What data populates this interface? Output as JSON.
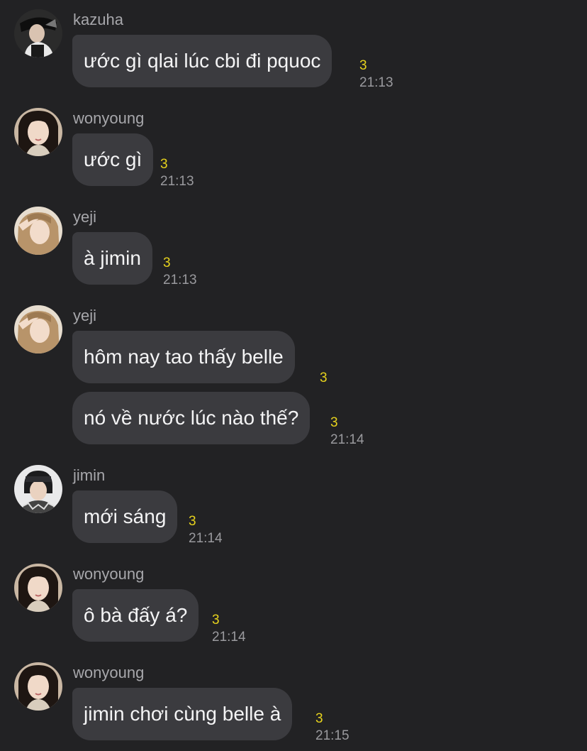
{
  "messages": [
    {
      "sender": "kazuha",
      "text": "ước gì qlai lúc cbi đi pquoc",
      "unread": "3",
      "time": "21:13"
    },
    {
      "sender": "wonyoung",
      "text": "ước gì",
      "unread": "3",
      "time": "21:13"
    },
    {
      "sender": "yeji",
      "text": "à jimin",
      "unread": "3",
      "time": "21:13"
    },
    {
      "sender": "yeji",
      "text": "hôm nay tao thấy belle",
      "unread": "3",
      "time": ""
    },
    {
      "sender": "",
      "text": "nó về nước lúc nào thế?",
      "unread": "3",
      "time": "21:14"
    },
    {
      "sender": "jimin",
      "text": "mới sáng",
      "unread": "3",
      "time": "21:14"
    },
    {
      "sender": "wonyoung",
      "text": "ô bà đấy á?",
      "unread": "3",
      "time": "21:14"
    },
    {
      "sender": "wonyoung",
      "text": "jimin chơi cùng belle à",
      "unread": "3",
      "time": "21:15"
    }
  ],
  "colors": {
    "background": "#222224",
    "bubble": "#3b3b3f",
    "unread": "#e6d21d",
    "time": "#9a9a9e"
  }
}
